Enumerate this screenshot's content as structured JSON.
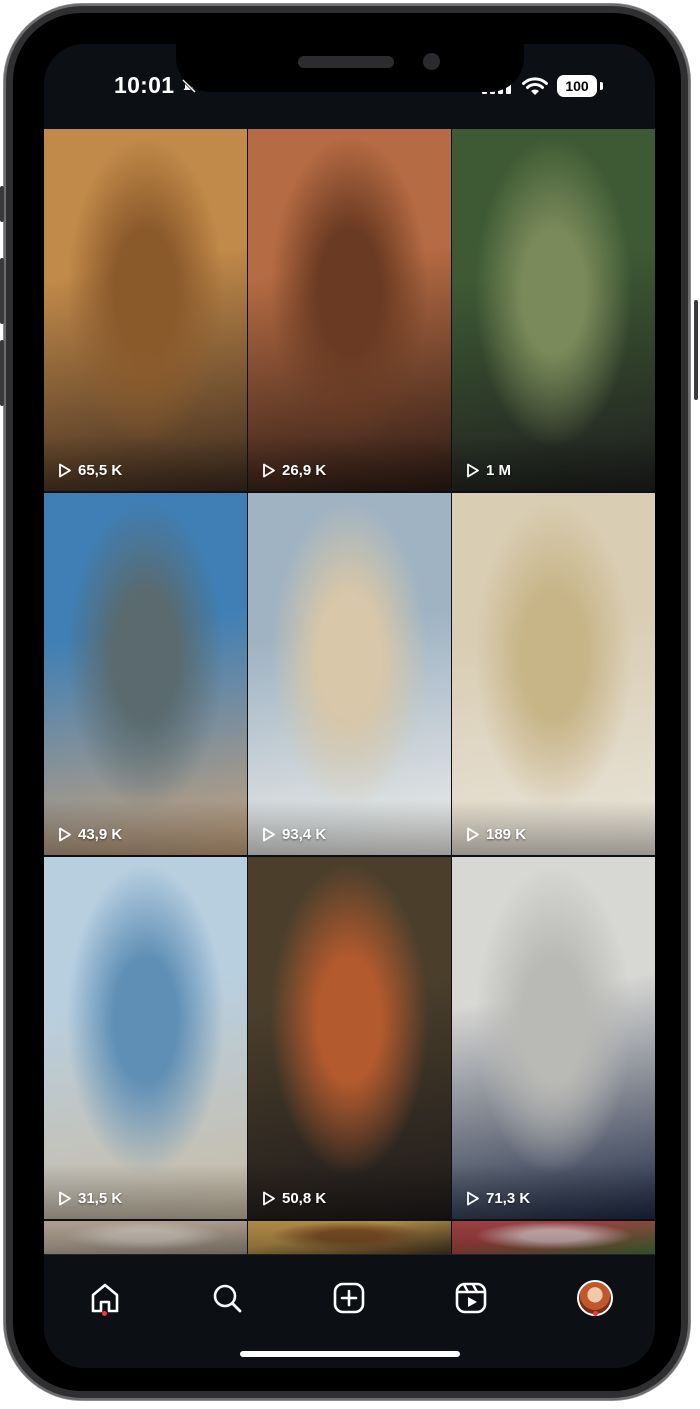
{
  "status_bar": {
    "time": "10:01",
    "battery": "100"
  },
  "posts": [
    {
      "views": "65,5 K",
      "colors": [
        "#c28a4a",
        "#8b5a2b",
        "#3b2a1e"
      ]
    },
    {
      "views": "26,9 K",
      "colors": [
        "#b56b43",
        "#6a3a22",
        "#2a1a14"
      ]
    },
    {
      "views": "1 M",
      "colors": [
        "#3e5a34",
        "#7a8a5a",
        "#1e1e1e"
      ]
    },
    {
      "views": "43,9 K",
      "colors": [
        "#3f7fb5",
        "#5a6a6e",
        "#c9a37c"
      ]
    },
    {
      "views": "93,4 K",
      "colors": [
        "#9fb3c3",
        "#d8c7a8",
        "#efeeea"
      ]
    },
    {
      "views": "189 K",
      "colors": [
        "#d9cdb3",
        "#c7b487",
        "#e9e4da"
      ]
    },
    {
      "views": "31,5 K",
      "colors": [
        "#b8cfe0",
        "#5f8fb5",
        "#c9bba4"
      ]
    },
    {
      "views": "50,8 K",
      "colors": [
        "#4b3f2c",
        "#b35a2e",
        "#1e1a1a"
      ]
    },
    {
      "views": "71,3 K",
      "colors": [
        "#d7d7d4",
        "#b9b9b5",
        "#1f2a44"
      ]
    },
    {
      "views": "",
      "colors": [
        "#c9b9a8",
        "#e6dcd0",
        "#a89a8a"
      ]
    },
    {
      "views": "",
      "colors": [
        "#c9a052",
        "#8a5a2c",
        "#4a3a22"
      ]
    },
    {
      "views": "",
      "colors": [
        "#b44a4a",
        "#e8c7c7",
        "#4a7a3a"
      ]
    }
  ],
  "tab_bar": {
    "items": [
      {
        "name": "home",
        "icon": "home-icon",
        "notification_dot": true
      },
      {
        "name": "search",
        "icon": "search-icon",
        "notification_dot": false
      },
      {
        "name": "create",
        "icon": "plus-square-icon",
        "notification_dot": false
      },
      {
        "name": "reels",
        "icon": "reels-icon",
        "notification_dot": false
      },
      {
        "name": "profile",
        "icon": "avatar",
        "notification_dot": true
      }
    ]
  },
  "theme": {
    "background": "#0c0f14",
    "accent_dot": "#ff3040",
    "text": "#ffffff"
  }
}
